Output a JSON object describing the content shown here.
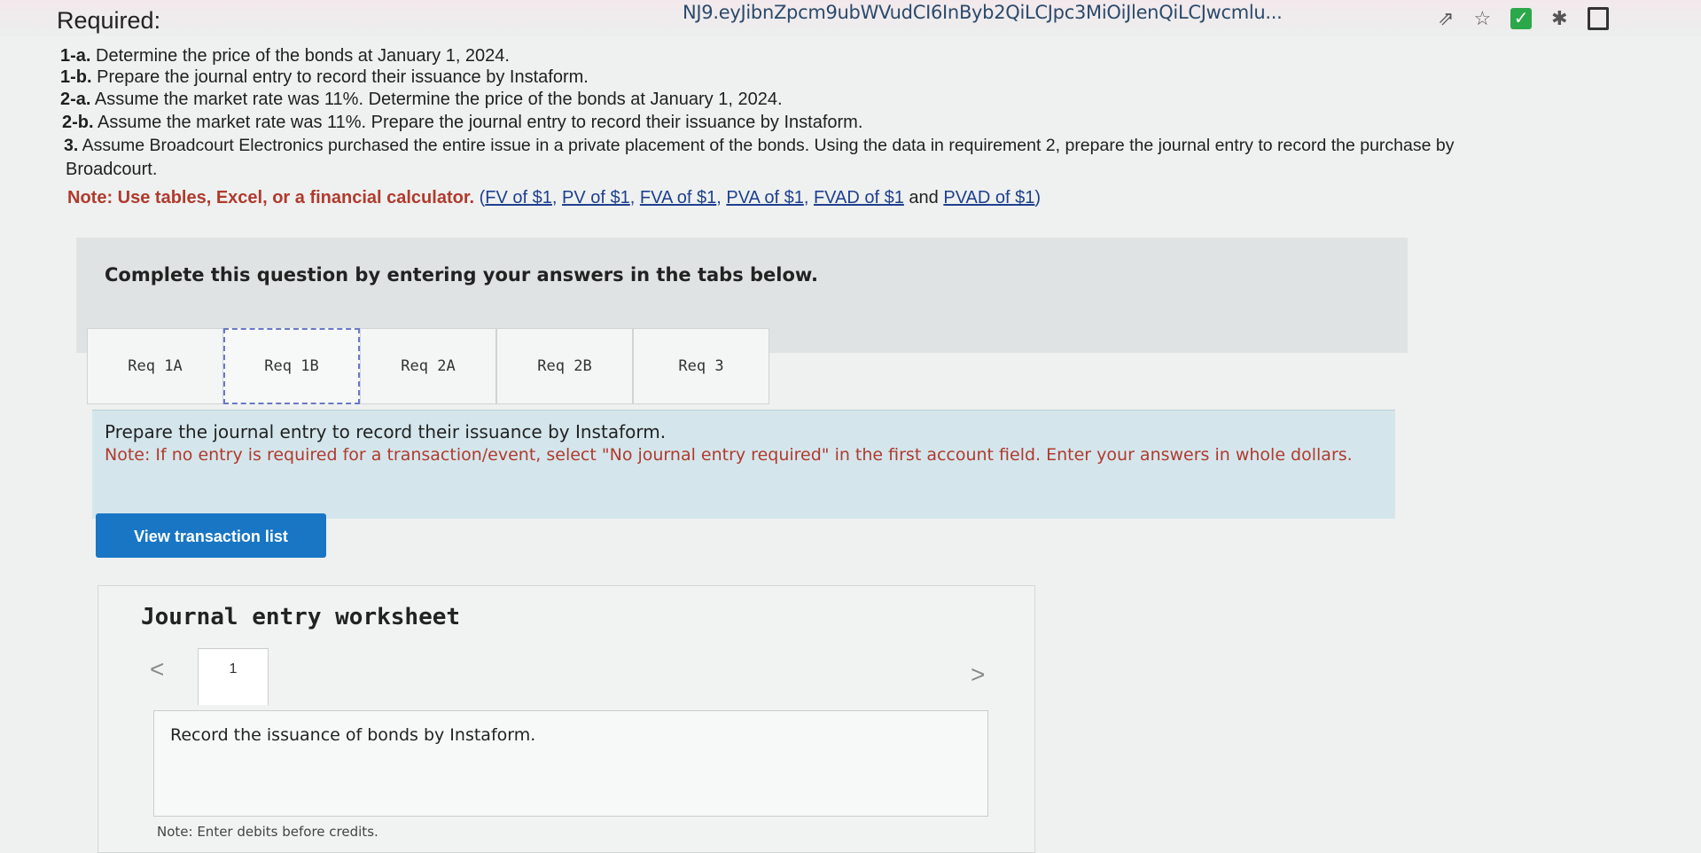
{
  "browser": {
    "url": "NJ9.eyJibnZpcm9ubWVudCI6InByb2QiLCJpc3MiOiJlenQiLCJwcmlu...",
    "icons": [
      "share-icon",
      "star-icon",
      "check-extension-icon",
      "puzzle-icon",
      "square-icon"
    ],
    "check_mark": "✓"
  },
  "requirements": {
    "title": "Required:",
    "items": [
      {
        "label": "1-a.",
        "text": " Determine the price of the bonds at January 1, 2024."
      },
      {
        "label": "1-b.",
        "text": " Prepare the journal entry to record their issuance by Instaform."
      },
      {
        "label": "2-a.",
        "text": " Assume the market rate was 11%. Determine the price of the bonds at January 1, 2024."
      },
      {
        "label": "2-b.",
        "text": " Assume the market rate was 11%. Prepare the journal entry to record their issuance by Instaform."
      },
      {
        "label": "3.",
        "text": " Assume Broadcourt Electronics purchased the entire issue in a private placement of the bonds. Using the data in requirement 2, prepare the journal entry to record the purchase by"
      }
    ],
    "continuation": "Broadcourt.",
    "note_label": "Note: Use tables, Excel, or a financial calculator.",
    "links": [
      "FV of $1",
      "PV of $1",
      "FVA of $1",
      "PVA of $1",
      "FVAD of $1",
      "PVAD of $1"
    ],
    "link_sep": ", ",
    "and_text": " and "
  },
  "complete_text": "Complete this question by entering your answers in the tabs below.",
  "tabs": [
    {
      "label": "Req 1A",
      "active": false
    },
    {
      "label": "Req 1B",
      "active": true
    },
    {
      "label": "Req 2A",
      "active": false
    },
    {
      "label": "Req 2B",
      "active": false
    },
    {
      "label": "Req 3",
      "active": false
    }
  ],
  "instructions": {
    "line1": "Prepare the journal entry to record their issuance by Instaform.",
    "line2": "Note: If no entry is required for a transaction/event, select \"No journal entry required\" in the first account field. Enter your answers in whole dollars."
  },
  "view_button": "View transaction list",
  "worksheet": {
    "title": "Journal entry worksheet",
    "tab_number": "1",
    "description": "Record the issuance of bonds by Instaform.",
    "note": "Note: Enter debits before credits.",
    "prev": "<",
    "next": ">"
  }
}
